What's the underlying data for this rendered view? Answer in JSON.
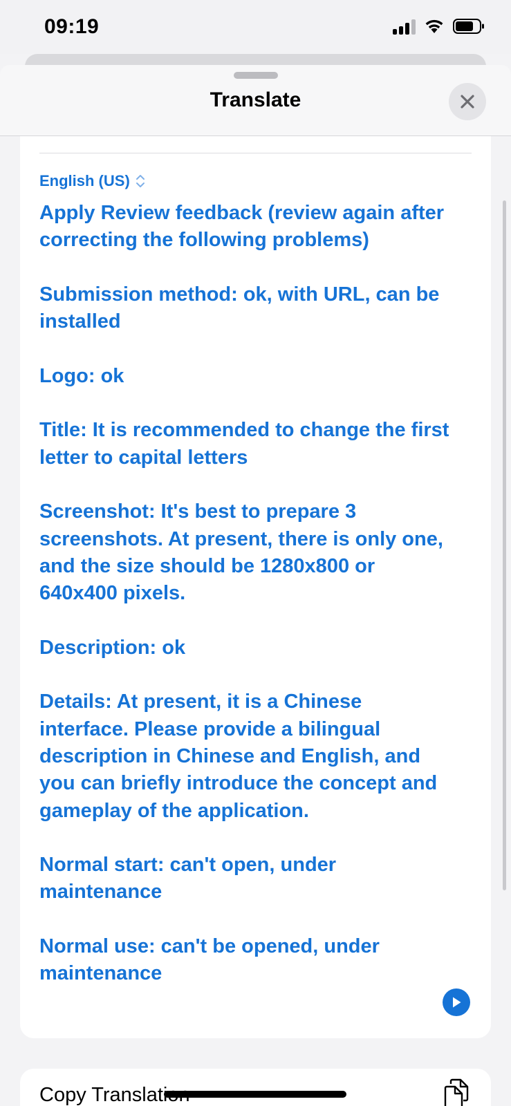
{
  "status_bar": {
    "time": "09:19"
  },
  "sheet": {
    "title": "Translate"
  },
  "translation": {
    "language": "English (US)",
    "paragraphs": [
      "Apply Review feedback (review again after correcting the following problems)",
      "Submission method: ok, with URL, can be installed",
      "Logo: ok",
      "Title: It is recommended to change the first letter to capital letters",
      "Screenshot: It's best to prepare 3 screenshots. At present, there is only one, and the size should be 1280x800 or 640x400 pixels.",
      "Description: ok",
      "Details: At present, it is a Chinese interface. Please provide a bilingual description in Chinese and English, and you can briefly introduce the concept and gameplay of the application.",
      "Normal start: can't open, under maintenance",
      "Normal use: can't be opened, under maintenance"
    ]
  },
  "actions": {
    "copy_label": "Copy Translation"
  },
  "icons": {
    "close": "close-icon",
    "language_chevron": "chevron-up-down-icon",
    "play": "play-icon",
    "copy": "copy-icon",
    "signal": "signal-icon",
    "wifi": "wifi-icon",
    "battery": "battery-icon"
  },
  "colors": {
    "accent": "#1673d6",
    "background": "#f3f3f5",
    "card": "#ffffff"
  }
}
